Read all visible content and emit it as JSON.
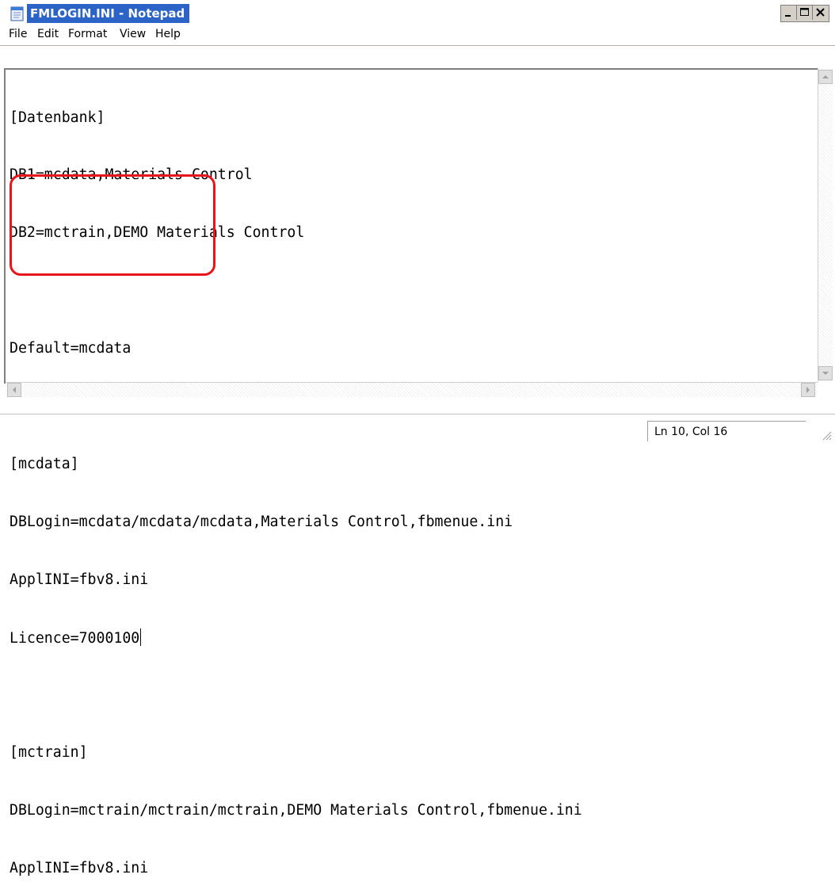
{
  "window": {
    "title": "FMLOGIN.INI - Notepad",
    "accent_color": "#2b64c6",
    "controls": [
      {
        "icon": "minimize-icon"
      },
      {
        "icon": "maximize-icon"
      },
      {
        "icon": "close-icon"
      }
    ]
  },
  "menu": {
    "items": [
      "File",
      "Edit",
      "Format",
      "View",
      "Help"
    ]
  },
  "editor": {
    "lines": [
      "[Datenbank]",
      "DB1=mcdata,Materials Control",
      "DB2=mctrain,DEMO Materials Control",
      "",
      "Default=mcdata",
      "",
      "[mcdata]",
      "DBLogin=mcdata/mcdata/mcdata,Materials Control,fbmenue.ini",
      "ApplINI=fbv8.ini",
      "Licence=7000100",
      "",
      "[mctrain]",
      "DBLogin=mctrain/mctrain/mctrain,DEMO Materials Control,fbmenue.ini",
      "ApplINI=fbv8.ini"
    ],
    "caret_line": 10,
    "highlight_color": "#e8151b"
  },
  "status": {
    "position": "Ln 10, Col 16"
  }
}
